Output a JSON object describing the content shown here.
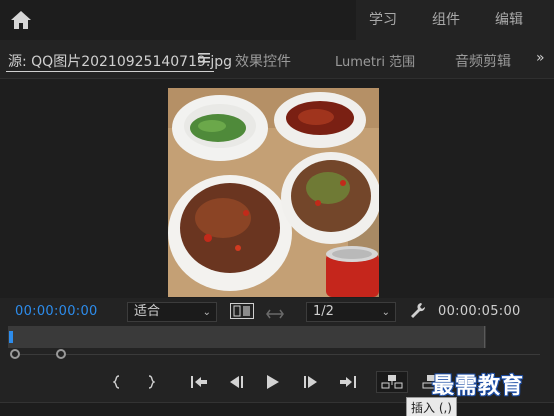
{
  "workspace_tabs": [
    "学习",
    "组件",
    "编辑"
  ],
  "panel_tabs": {
    "source": "源: QQ图片20210925140719.jpg",
    "effects": "效果控件",
    "lumetri": "Lumetri 范围",
    "audio": "音频剪辑"
  },
  "timecode": {
    "current": "00:00:00:00",
    "duration": "00:00:05:00"
  },
  "zoom_select": "适合",
  "resolution_select": "1/2",
  "tooltip": "插入 (,)",
  "watermark": "最需教育",
  "colors": {
    "accent": "#2d8ceb",
    "bg": "#232323"
  }
}
